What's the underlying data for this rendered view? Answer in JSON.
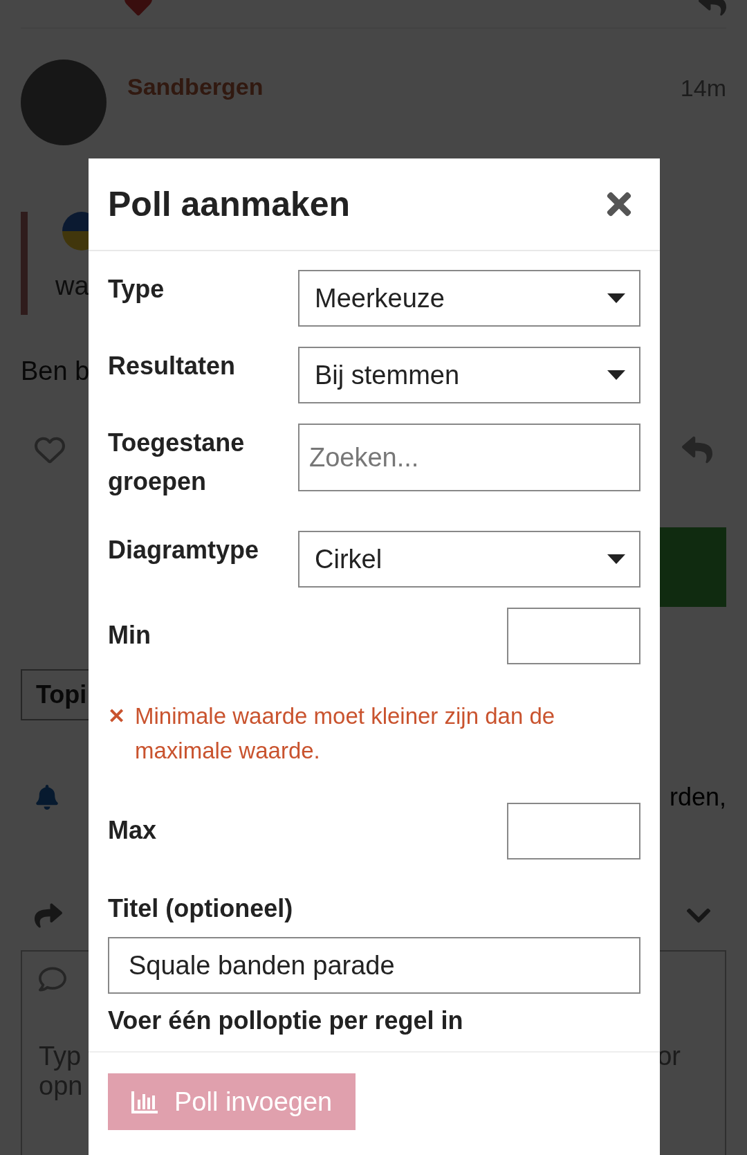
{
  "background": {
    "author": "Sandbergen",
    "time": "14m",
    "quote_text": "wa",
    "post_text": "Ben b",
    "topic_button": "Topi",
    "notice_text": "rden,",
    "composer_lines": [
      "Typ",
      "opn"
    ],
    "composer_side": "or"
  },
  "dialog": {
    "title": "Poll aanmaken",
    "fields": [
      {
        "kind": "select",
        "label": "Type",
        "value": "Meerkeuze"
      },
      {
        "kind": "select",
        "label": "Resultaten",
        "value": "Bij stemmen"
      },
      {
        "kind": "search",
        "label": "Toegestane groepen",
        "placeholder": "Zoeken..."
      },
      {
        "kind": "select",
        "label": "Diagramtype",
        "value": "Cirkel"
      },
      {
        "kind": "number",
        "label": "Min"
      },
      {
        "kind": "error",
        "icon": "✕",
        "text": "Minimale waarde moet kleiner zijn dan de maximale waarde."
      },
      {
        "kind": "number",
        "label": "Max"
      },
      {
        "kind": "text",
        "label": "Titel (optioneel)",
        "value": "Squale banden parade"
      },
      {
        "kind": "heading",
        "label": "Voer één polloptie per regel in"
      }
    ],
    "submit": "Poll invoegen"
  }
}
